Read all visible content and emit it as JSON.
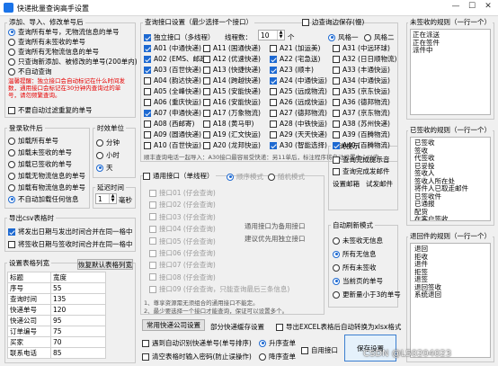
{
  "window": {
    "title": "快递批量查询高手设置",
    "minimize": "—",
    "maximize": "☐",
    "close": "✕"
  },
  "add_group": {
    "title": "添加、导入、修改单号后",
    "options": [
      "查询所有单号，无物流信息的单号",
      "查询所有未签收的单号",
      "查询所有无物流信息的单号",
      "只查询新添加、被修改的单号(200单内)",
      "不自动查询"
    ],
    "notice": "温馨提醒：独立接口会自动标记在什么时间发数，通用接口会标记在30分钟内查询过的单号，请勿频繁查询。",
    "no_repeat": "不要自动过滤重复的单号"
  },
  "login_group": {
    "title": "登录软件后",
    "options": [
      "加载所有单号",
      "加载未签收的单号",
      "加载已签收的单号",
      "加载无物流信息的单号",
      "加载有物流信息的单号",
      "不自动加载任何信息"
    ]
  },
  "time_group": {
    "title": "时效单位",
    "options": [
      "分钟",
      "小时",
      "天"
    ]
  },
  "delay_group": {
    "title": "延迟时间",
    "value": "1",
    "unit": "毫秒"
  },
  "export_group": {
    "title": "导出csv表格时",
    "opt1": "将发出日期与发出时间合并在同一格中",
    "opt2": "将签收日期与签收时间合并在同一格中"
  },
  "table_group": {
    "title": "设置表格列宽",
    "restore": "恢复默认表格列宽",
    "headers": [
      "标题",
      "宽度"
    ],
    "rows": [
      [
        "序号",
        "55"
      ],
      [
        "查询时间",
        "135"
      ],
      [
        "快递单号",
        "120"
      ],
      [
        "快递公司",
        "95"
      ],
      [
        "订单编号",
        "75"
      ],
      [
        "买家",
        "70"
      ],
      [
        "联系电话",
        "85"
      ]
    ]
  },
  "api_group": {
    "title": "查询接口设置（最少选择一个接口）",
    "independent": "独立接口（多线程）",
    "threads_label": "线程数：",
    "threads": "10",
    "threads_unit": "个",
    "apis": [
      [
        "A01 (中通快递)",
        "A11 (国通快递)",
        "A21 (加运美)",
        "A31 (中远环球)"
      ],
      [
        "A02 (EMS、邮政)",
        "A12 (优速快递)",
        "A22 (宅急送)",
        "A32 (日日顺物流)"
      ],
      [
        "A03 (百世快递)",
        "A13 (快捷快递)",
        "A23 (顺丰)",
        "A33 (丰通快运)"
      ],
      [
        "A04 (韵达快递)",
        "A14 (跨越快递)",
        "A24 (中通快运)",
        "A34 (中通快运)"
      ],
      [
        "A05 (全峰快递)",
        "A15 (安能快递)",
        "A25 (远成物流)",
        "A35 (京东快运)"
      ],
      [
        "A06 (重庆快运)",
        "A16 (安能快运)",
        "A26 (远成快运)",
        "A36 (德邦物流)"
      ],
      [
        "A07 (申通快递)",
        "A17 (万象物流)",
        "A27 (德邦物流)",
        "A37 (京东物流)"
      ],
      [
        "A08 (西邮寄)",
        "A18 (黄马甲)",
        "A28 (中铁快运)",
        "A38 (苏州快递)"
      ],
      [
        "A09 (圆通快递)",
        "A19 (汇文快运)",
        "A29 (天天快递)",
        "A39 (百腾物流)"
      ],
      [
        "A10 (百世快运)",
        "A20 (龙邦快运)",
        "A30 (智能选择)",
        "A40 (百腾物流)"
      ]
    ],
    "api_on": [
      [
        1,
        0,
        0,
        0
      ],
      [
        1,
        0,
        1,
        0
      ],
      [
        1,
        0,
        1,
        0
      ],
      [
        0,
        0,
        1,
        0
      ],
      [
        0,
        0,
        0,
        0
      ],
      [
        0,
        0,
        0,
        0
      ],
      [
        1,
        0,
        0,
        0
      ],
      [
        0,
        0,
        0,
        0
      ],
      [
        0,
        0,
        0,
        0
      ],
      [
        0,
        0,
        1,
        1
      ]
    ],
    "note": "顺丰查询电话一起导入：A30接口最容易受快递：另11单后，标注程序将自动设置中心以内。",
    "sidebar_check": "边查询边保存(慢)",
    "style1": "风格一",
    "style2": "风格二"
  },
  "general_group": {
    "title": "通用接口（单线程）",
    "mode1": "顺序模式",
    "mode2": "随机模式",
    "items": [
      "接口01 (仔会查询)",
      "接口02 (仔会查询)",
      "接口03 (仔会查询)",
      "接口04 (仔会查询)",
      "接口05 (仔会查询)",
      "接口06 (仔会查询)",
      "接口07 (仔会查询)",
      "接口08 (仔会查询)",
      "接口09 (仔会查询，只能查询最后三条信息)"
    ],
    "hint1": "通用接口为备用接口",
    "hint2": "建议优先用独立接口",
    "foot1": "1、尊享资源需无须组合的通用接口不能定。",
    "foot2": "2、最少要选择一个接口才能查询，保证可以设置多个。"
  },
  "query_tip": {
    "title": "查询提示",
    "opt1": "查询完成提示音",
    "opt2": "查询完成发邮件",
    "btn1": "设置邮箱",
    "btn2": "试发邮件"
  },
  "auto_refresh": {
    "title": "自动刷新模式",
    "options": [
      "未签收无信息",
      "所有无信息",
      "所有未签收",
      "当前页的单号",
      "更新量小于3的单号"
    ]
  },
  "bottom": {
    "common_settings": "常用快递公司设置",
    "part_cache": "部分快递缓存设置",
    "export_excel": "导出EXCEL表格后自动转换为xlsx格式",
    "auto_recognize": "遇到自动识别快递单号(单号排序)",
    "clear_table": "清空表格时输入密码(防止误操作)",
    "asc": "升序查单",
    "desc": "降序查单",
    "auto_api": "自用接口",
    "save": "保存设置"
  },
  "signed_rule": {
    "title": "未签收的规则（一行一个）",
    "items": [
      "正在派送",
      "正在签件",
      "派件中"
    ]
  },
  "done_rule": {
    "title": "已签收的规则（一行一个）",
    "items": [
      "已签收",
      "签收",
      "代签收",
      "已妥投",
      "签收人",
      "签收人所在处",
      "将件人已取走邮件",
      "已签收件",
      "已通报",
      "配货",
      "在客户签收",
      "已收到货，谢谢",
      "派件成功",
      "派送成功",
      "本人签收"
    ]
  },
  "return_rule": {
    "title": "退回件的规则（一行一个）",
    "items": [
      "退回",
      "拒收",
      "退件",
      "拒签",
      "退签",
      "退回签收",
      "系统退回"
    ]
  },
  "watermark": "CSDN @L50204023"
}
